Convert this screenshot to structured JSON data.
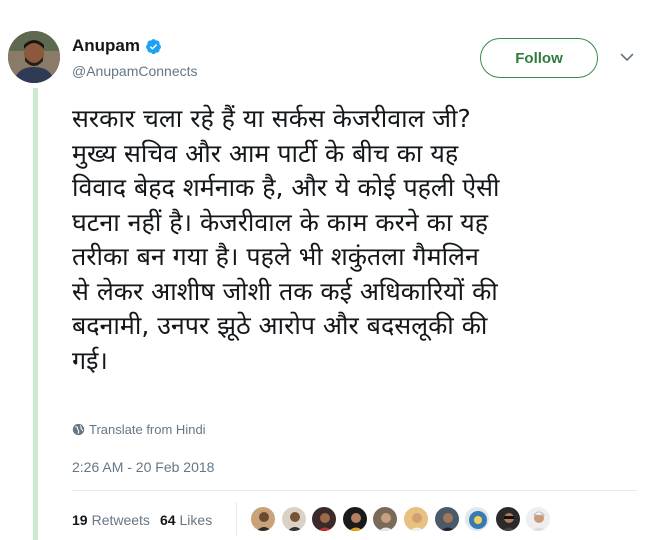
{
  "tweet": {
    "author_name": "Anupam",
    "author_handle": "@AnupamConnects",
    "follow_label": "Follow",
    "text": "सरकार चला रहे हैं या सर्कस केजरीवाल जी?\nमुख्य सचिव और आम पार्टी के बीच का यह\nविवाद बेहद शर्मनाक है, और ये कोई पहली ऐसी\nघटना नहीं है। केजरीवाल के काम करने का यह\nतरीका बन गया है। पहले भी शकुंतला गैमलिन\nसे लेकर आशीष जोशी तक कई अधिकारियों की\nबदनामी, उनपर झूठे आरोप और बदसलूकी की\nगई।",
    "translate_label": "Translate from Hindi",
    "timestamp": "2:26 AM - 20 Feb 2018",
    "retweets_count": "19",
    "retweets_label": "Retweets",
    "likes_count": "64",
    "likes_label": "Likes"
  },
  "icons": {
    "verified": "verified-badge-icon",
    "chevron": "chevron-down-icon",
    "globe": "globe-icon"
  },
  "colors": {
    "follow_accent": "#2e7d3e",
    "verified": "#1da1f2",
    "secondary_text": "#657786",
    "thread_rule": "#cfe9cf"
  },
  "likers_count_shown": 9
}
